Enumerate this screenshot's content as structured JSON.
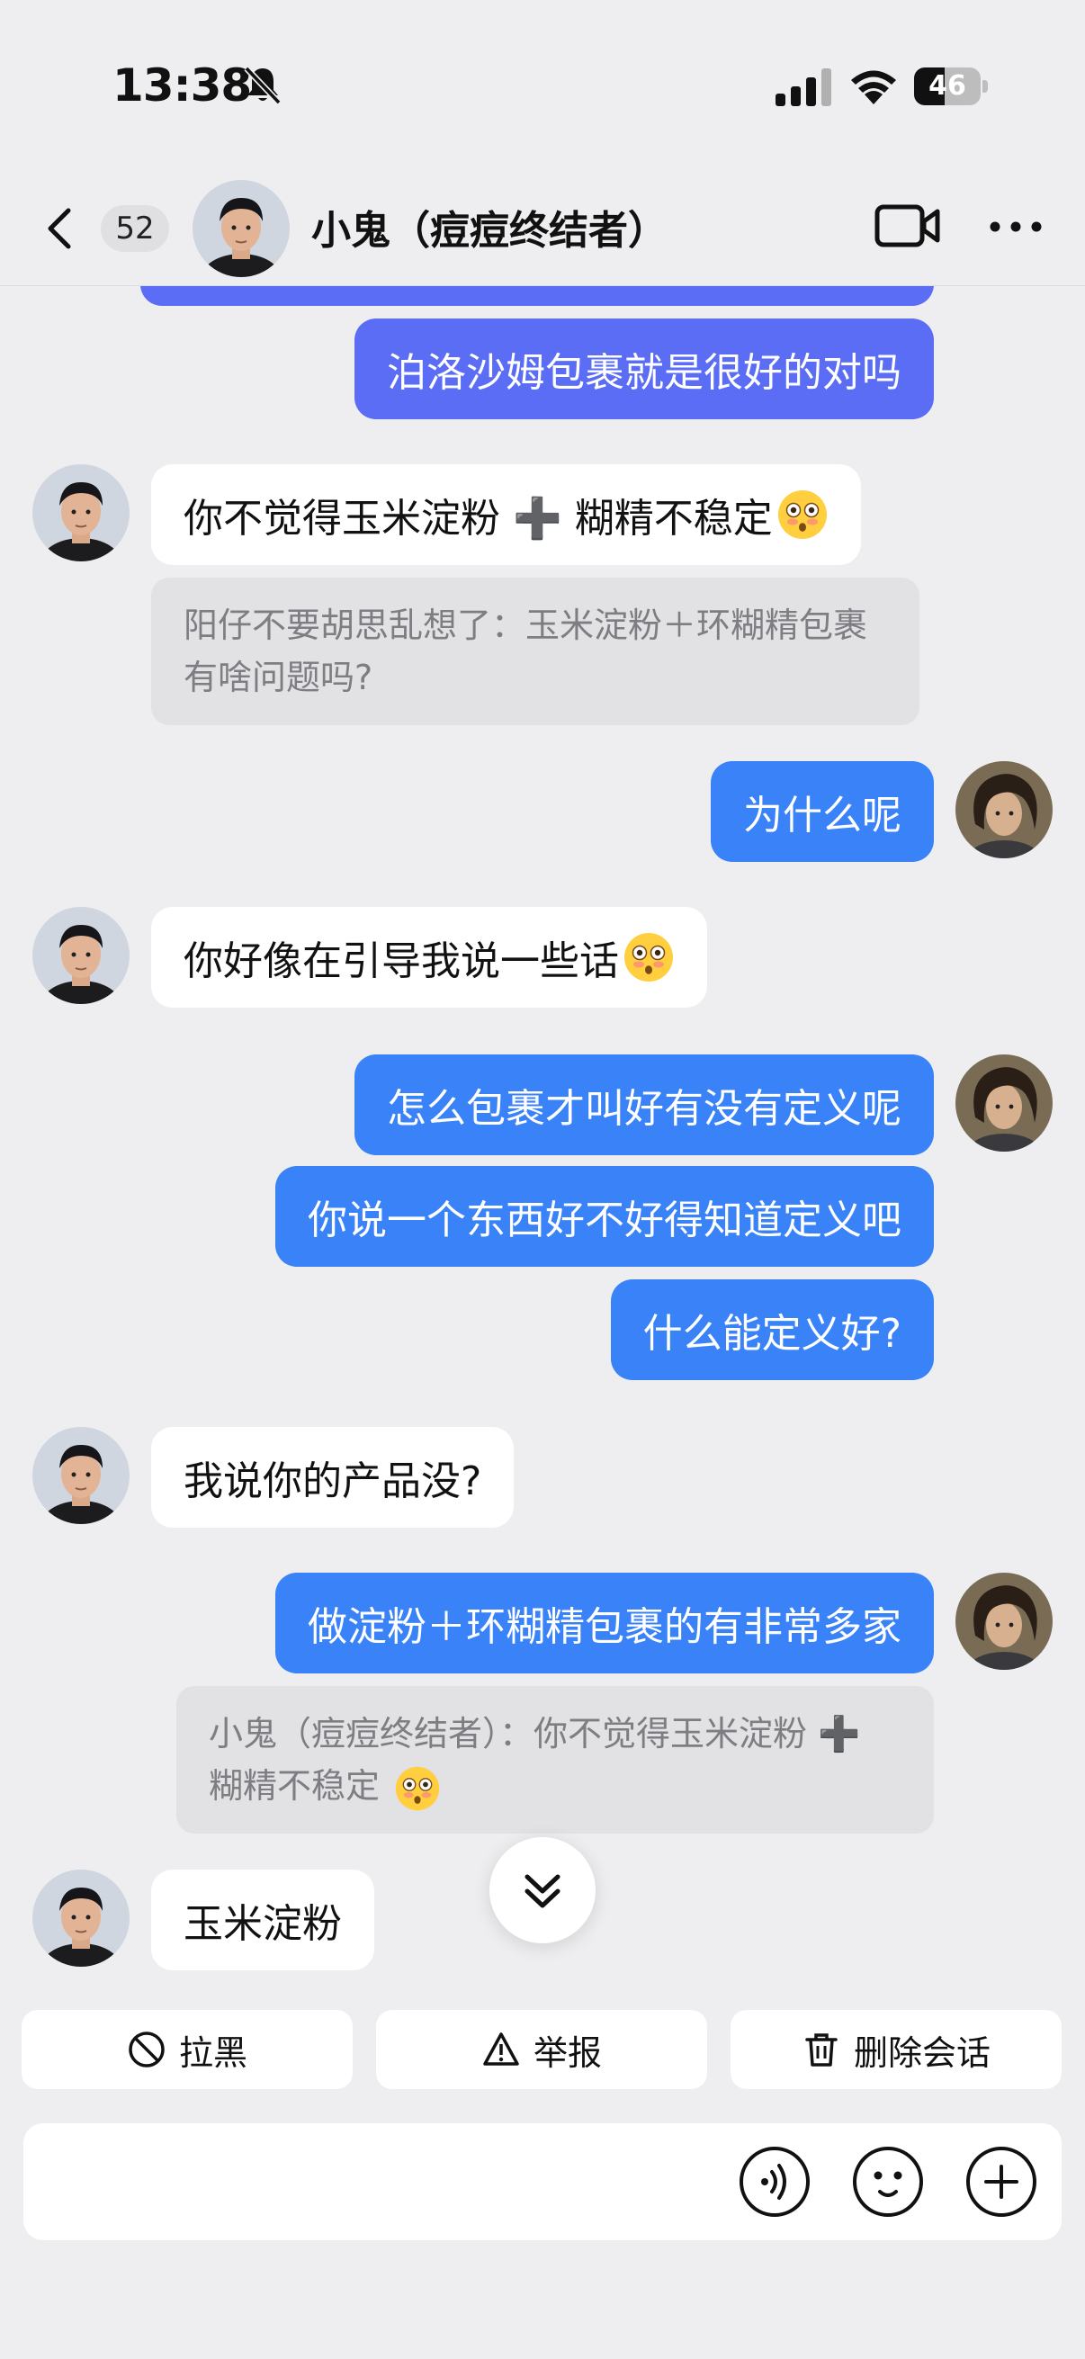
{
  "status_bar": {
    "time": "13:38",
    "battery": "46",
    "battery_level": 0.46
  },
  "header": {
    "unread_count": "52",
    "contact_name": "小鬼（痘痘终结者）"
  },
  "messages": {
    "m0": "泊洛沙姆包裹就是很好的对吗",
    "m1": "你不觉得玉米淀粉 ➕ 糊精不稳定",
    "q1": "阳仔不要胡思乱想了：玉米淀粉＋环糊精包裹有啥问题吗?",
    "m2": "为什么呢",
    "m3": "你好像在引导我说一些话",
    "m4": "怎么包裹才叫好有没有定义呢",
    "m5": "你说一个东西好不好得知道定义吧",
    "m6": "什么能定义好?",
    "m7": "我说你的产品没?",
    "m8": "做淀粉＋环糊精包裹的有非常多家",
    "q8": "小鬼（痘痘终结者）：你不觉得玉米淀粉 ➕ 糊精不稳定",
    "m9": "玉米淀粉"
  },
  "actions": {
    "block": "拉黑",
    "report": "举报",
    "delete": "删除会话"
  },
  "input": {
    "placeholder": ""
  },
  "colors": {
    "outgoing": "#3a82f7",
    "outgoing_highlight": "#5a6df4",
    "incoming": "#ffffff",
    "background": "#eeeef0"
  }
}
